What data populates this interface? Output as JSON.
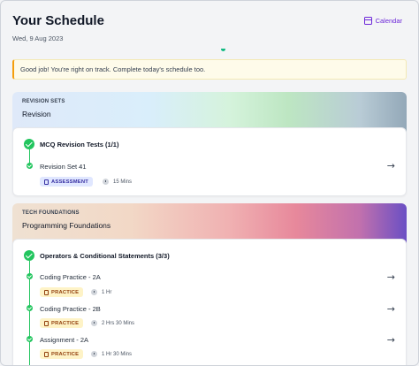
{
  "header": {
    "title": "Your Schedule",
    "date": "Wed, 9 Aug 2023",
    "calendar_label": "Calendar"
  },
  "banner": {
    "message": "Good job! You're right on track. Complete today's schedule too."
  },
  "sections": [
    {
      "label": "REVISION SETS",
      "name": "Revision",
      "groups": [
        {
          "title": "MCQ Revision Tests (1/1)",
          "items": [
            {
              "name": "Revision Set 41",
              "badge": "ASSESSMENT",
              "duration": "15 Mins"
            }
          ]
        }
      ]
    },
    {
      "label": "TECH FOUNDATIONS",
      "name": "Programming Foundations",
      "groups": [
        {
          "title": "Operators & Conditional Statements (3/3)",
          "items": [
            {
              "name": "Coding Practice - 2A",
              "badge": "PRACTICE",
              "duration": "1 Hr"
            },
            {
              "name": "Coding Practice - 2B",
              "badge": "PRACTICE",
              "duration": "2 Hrs 30 Mins"
            },
            {
              "name": "Assignment - 2A",
              "badge": "PRACTICE",
              "duration": "1 Hr 30 Mins"
            }
          ]
        }
      ]
    }
  ],
  "icons": {
    "calendar": "calendar-icon",
    "check": "check-circle-icon",
    "arrow": "arrow-right-icon",
    "clock": "clock-icon",
    "badge": "clipboard-icon"
  },
  "colors": {
    "accent": "#6d28d9",
    "success": "#22c55e",
    "assessment_bg": "#e0e7ff",
    "practice_bg": "#fef3c7"
  }
}
